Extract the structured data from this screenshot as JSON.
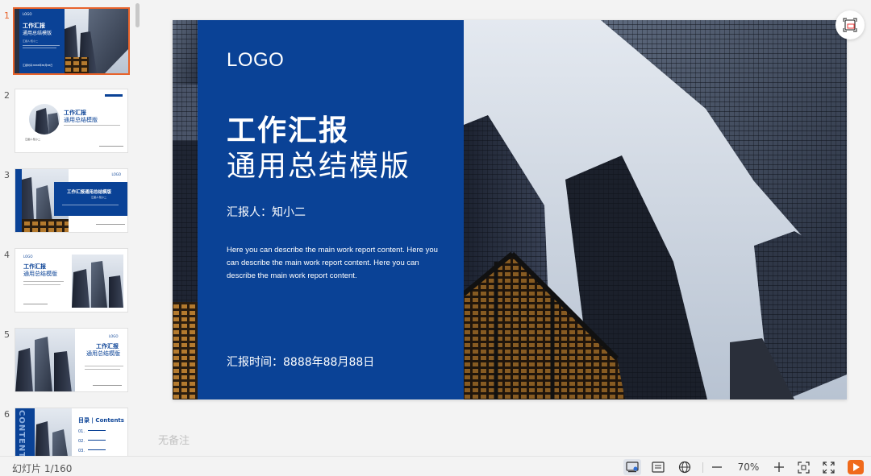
{
  "thumbnails": [
    {
      "number": "1",
      "active": true,
      "logo": "LOGO",
      "title1": "工作汇报",
      "title2": "通用总结模版",
      "reporter": "汇报人:知小二",
      "time": "汇报时间:8888年88月88日"
    },
    {
      "number": "2",
      "active": false,
      "title1": "工作汇报",
      "title2": "通用总结模版",
      "reporter": "汇报人:知小二"
    },
    {
      "number": "3",
      "active": false,
      "logo": "LOGO",
      "title1": "工作汇报通用总结模版",
      "reporter": "汇报人:知小二"
    },
    {
      "number": "4",
      "active": false,
      "logo": "LOGO",
      "title1": "工作汇报",
      "title2": "通用总结模版"
    },
    {
      "number": "5",
      "active": false,
      "logo": "LOGO",
      "title1": "工作汇报",
      "title2": "通用总结模版"
    },
    {
      "number": "6",
      "active": false,
      "side_text": "CONTENTS",
      "title1": "目录 | Contents",
      "items": [
        "01.",
        "02.",
        "03."
      ]
    }
  ],
  "slide": {
    "logo": "LOGO",
    "title_bold": "工作汇报",
    "title_light": "通用总结模版",
    "reporter": "汇报人：知小二",
    "description": "Here you can describe the main work report content. Here you can describe the main work report content. Here you can describe the main work report content.",
    "time": "汇报时间：8888年88月88日",
    "panel_color": "#0a4296"
  },
  "notes_placeholder": "无备注",
  "statusbar": {
    "slide_counter": "幻灯片 1/160",
    "zoom": "70%",
    "icons": [
      "normal-view-icon",
      "notes-view-icon",
      "web-icon",
      "zoom-out-icon",
      "zoom-in-icon",
      "fit-window-icon",
      "fullscreen-icon",
      "play-icon"
    ]
  },
  "colors": {
    "accent": "#e8632b",
    "brand_blue": "#0a4296"
  }
}
